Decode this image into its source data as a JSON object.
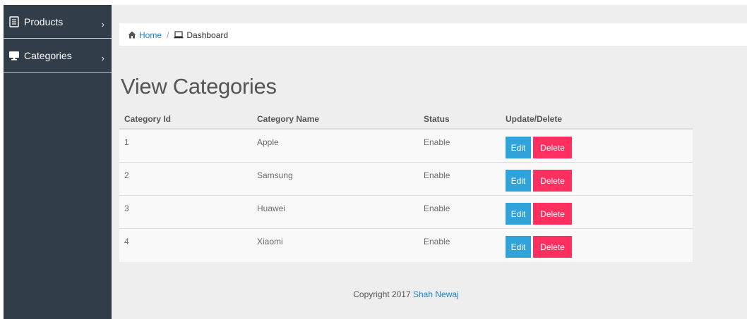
{
  "sidebar": {
    "items": [
      {
        "label": "Products",
        "icon": "document-list-icon",
        "chevron": "›"
      },
      {
        "label": "Categories",
        "icon": "monitor-icon",
        "chevron": "›"
      }
    ]
  },
  "breadcrumb": {
    "home": "Home",
    "separator": "/",
    "current": "Dashboard"
  },
  "page": {
    "title": "View Categories"
  },
  "table": {
    "headers": [
      "Category Id",
      "Category Name",
      "Status",
      "Update/Delete"
    ],
    "rows": [
      {
        "id": "1",
        "name": "Apple",
        "status": "Enable",
        "edit": "Edit",
        "delete": "Delete"
      },
      {
        "id": "2",
        "name": "Samsung",
        "status": "Enable",
        "edit": "Edit",
        "delete": "Delete"
      },
      {
        "id": "3",
        "name": "Huawei",
        "status": "Enable",
        "edit": "Edit",
        "delete": "Delete"
      },
      {
        "id": "4",
        "name": "Xiaomi",
        "status": "Enable",
        "edit": "Edit",
        "delete": "Delete"
      }
    ]
  },
  "footer": {
    "text": "Copyright 2017",
    "author": "Shah Newaj"
  },
  "colors": {
    "sidebar_bg": "#323d4a",
    "page_bg": "#eeeeee",
    "link": "#1f7fd1",
    "edit_button": "#2fa3da",
    "delete_button": "#ff2f5f"
  }
}
